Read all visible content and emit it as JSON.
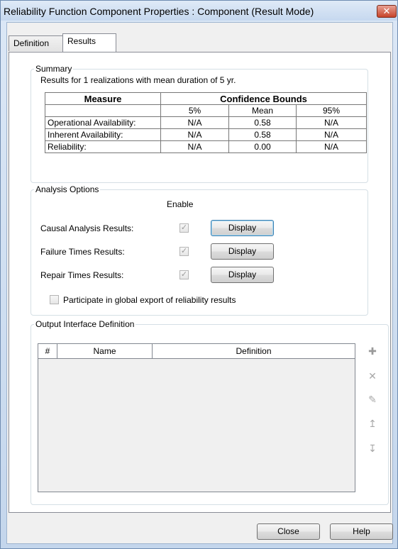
{
  "window": {
    "title": "Reliability Function Component Properties : Component (Result Mode)",
    "close_glyph": "✕"
  },
  "tabs": [
    {
      "label": "Definition"
    },
    {
      "label": "Results"
    }
  ],
  "summary": {
    "legend": "Summary",
    "text": "Results for 1 realizations with mean duration of 5 yr.",
    "table": {
      "header_measure": "Measure",
      "header_bounds": "Confidence Bounds",
      "subheaders": [
        "5%",
        "Mean",
        "95%"
      ],
      "rows": [
        {
          "label": "Operational Availability:",
          "p5": "N/A",
          "mean": "0.58",
          "p95": "N/A"
        },
        {
          "label": "Inherent Availability:",
          "p5": "N/A",
          "mean": "0.58",
          "p95": "N/A"
        },
        {
          "label": "Reliability:",
          "p5": "N/A",
          "mean": "0.00",
          "p95": "N/A"
        }
      ]
    }
  },
  "analysis": {
    "legend": "Analysis Options",
    "enable_label": "Enable",
    "rows": [
      {
        "label": "Causal Analysis Results:",
        "enabled": true,
        "button": "Display"
      },
      {
        "label": "Failure Times Results:",
        "enabled": true,
        "button": "Display"
      },
      {
        "label": "Repair Times Results:",
        "enabled": true,
        "button": "Display"
      }
    ],
    "global_export_label": "Participate in global export of reliability results",
    "global_export_checked": false
  },
  "output": {
    "legend": "Output Interface Definition",
    "columns": [
      "#",
      "Name",
      "Definition"
    ],
    "icons": [
      "add-icon",
      "delete-icon",
      "edit-icon",
      "move-up-icon",
      "move-down-icon"
    ]
  },
  "footer": {
    "close_label": "Close",
    "help_label": "Help"
  }
}
